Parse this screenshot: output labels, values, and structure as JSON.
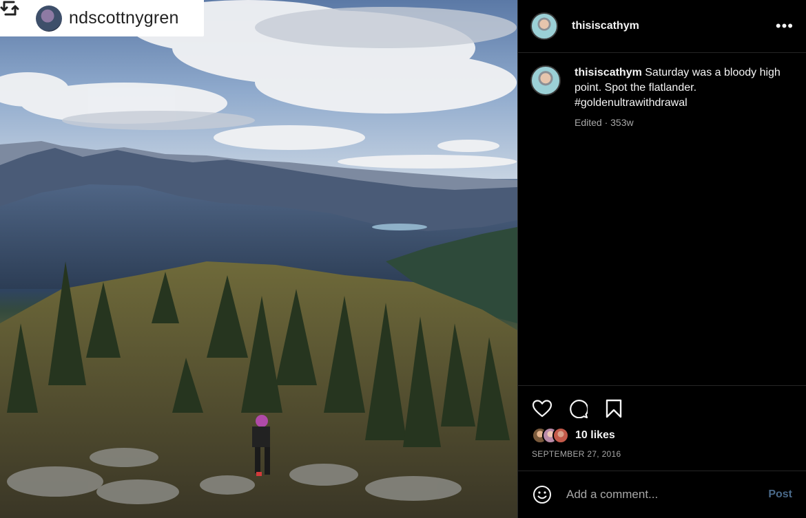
{
  "photo": {
    "alt": ""
  },
  "repost": {
    "username": "ndscottnygren"
  },
  "post": {
    "username": "thisiscathym",
    "caption_username": "thisiscathym",
    "caption_text": " Saturday was a bloody high point. Spot the flatlander. #goldenultrawithdrawal",
    "meta": "Edited · 353w",
    "likes": "10 likes",
    "date": "SEPTEMBER 27, 2016"
  },
  "comment": {
    "placeholder": "Add a comment...",
    "post_label": "Post"
  },
  "icons": {
    "repost": "repost-icon",
    "more": "more-options-icon",
    "like": "heart-icon",
    "comment": "comment-bubble-icon",
    "save": "bookmark-icon",
    "emoji": "emoji-icon"
  },
  "colors": {
    "post_button": "#4a6a8a",
    "panel_bg": "#000000",
    "muted": "#a8a8a8"
  }
}
